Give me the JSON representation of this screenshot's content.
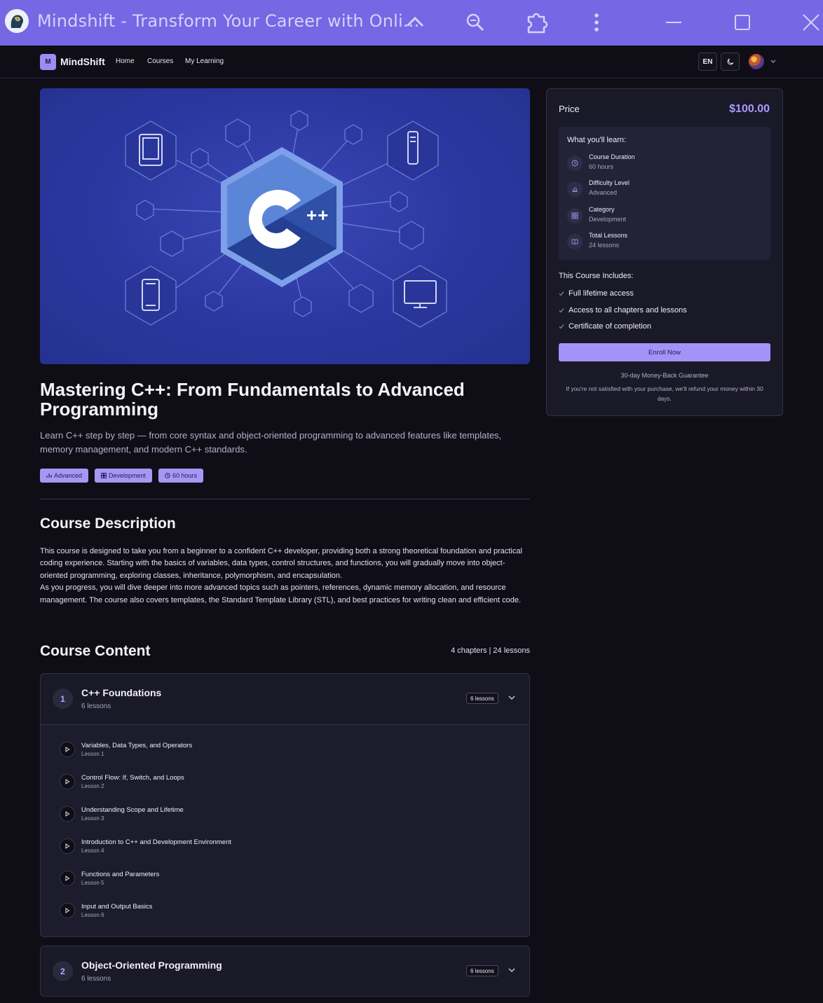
{
  "window": {
    "title": "Mindshift - Transform Your Career with Onli..."
  },
  "nav": {
    "logo_letter": "M",
    "brand": "MindShift",
    "links": [
      "Home",
      "Courses",
      "My Learning"
    ],
    "language": "EN"
  },
  "course": {
    "title": "Mastering C++: From Fundamentals to Advanced Programming",
    "subtitle": "Learn C++ step by step — from core syntax and object-oriented programming to advanced features like templates, memory management, and modern C++ standards.",
    "tags": [
      "Advanced",
      "Development",
      "60 hours"
    ],
    "hero_logo_text": "++"
  },
  "description": {
    "heading": "Course Description",
    "p1": "This course is designed to take you from a beginner to a confident C++ developer, providing both a strong theoretical foundation and practical coding experience. Starting with the basics of variables, data types, control structures, and functions, you will gradually move into object-oriented programming, exploring classes, inheritance, polymorphism, and encapsulation.",
    "p2": "As you progress, you will dive deeper into more advanced topics such as pointers, references, dynamic memory allocation, and resource management. The course also covers templates, the Standard Template Library (STL), and best practices for writing clean and efficient code."
  },
  "content": {
    "heading": "Course Content",
    "summary": "4 chapters | 24 lessons",
    "chapters": [
      {
        "num": "1",
        "title": "C++ Foundations",
        "count": "6 lessons",
        "badge": "6 lessons",
        "lessons": [
          {
            "title": "Variables, Data Types, and Operators",
            "sub": "Lesson 1"
          },
          {
            "title": "Control Flow: If, Switch, and Loops",
            "sub": "Lesson 2"
          },
          {
            "title": "Understanding Scope and Lifetime",
            "sub": "Lesson 3"
          },
          {
            "title": "Introduction to C++ and Development Environment",
            "sub": "Lesson 4"
          },
          {
            "title": "Functions and Parameters",
            "sub": "Lesson 5"
          },
          {
            "title": "Input and Output Basics",
            "sub": "Lesson 6"
          }
        ]
      },
      {
        "num": "2",
        "title": "Object-Oriented Programming",
        "count": "6 lessons",
        "badge": "6 lessons"
      }
    ]
  },
  "sidebar": {
    "price_label": "Price",
    "price": "$100.00",
    "learn_title": "What you'll learn:",
    "learn_items": [
      {
        "label": "Course Duration",
        "value": "60 hours",
        "icon": "clock-icon"
      },
      {
        "label": "Difficulty Level",
        "value": "Advanced",
        "icon": "bar-chart-icon"
      },
      {
        "label": "Category",
        "value": "Development",
        "icon": "grid-icon"
      },
      {
        "label": "Total Lessons",
        "value": "24 lessons",
        "icon": "book-icon"
      }
    ],
    "includes_title": "This Course Includes:",
    "includes": [
      "Full lifetime access",
      "Access to all chapters and lessons",
      "Certificate of completion"
    ],
    "enroll": "Enroll Now",
    "guarantee_title": "30-day Money-Back Guarantee",
    "guarantee_text": "If you're not satisfied with your purchase, we'll refund your money within 30 days."
  },
  "colors": {
    "titlebar": "#7667e4",
    "accent": "#a493f7",
    "background": "#0f0e17",
    "hero": "#2b379f"
  }
}
